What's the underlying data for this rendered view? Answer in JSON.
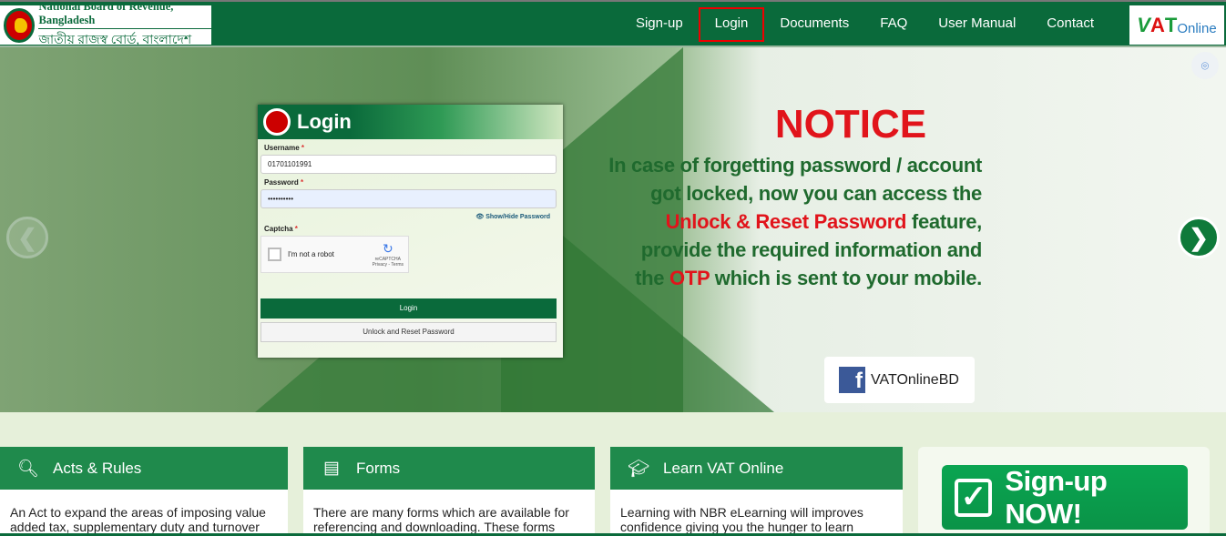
{
  "header": {
    "org_en": "National Board of Revenue, Bangladesh",
    "org_bn": "জাতীয় রাজস্ব বোর্ড, বাংলাদেশ",
    "nav": [
      "Sign-up",
      "Login",
      "Documents",
      "FAQ",
      "User Manual",
      "Contact"
    ],
    "active": "Login",
    "vat_logo": {
      "v": "V",
      "a": "A",
      "t": "T",
      "online": "Online"
    }
  },
  "hero": {
    "prev": "❮",
    "next": "❯",
    "zoom_icon": "⌾",
    "login": {
      "title": "Login",
      "username_label": "Username",
      "password_label": "Password",
      "required": "*",
      "username_value": "01701101991",
      "password_value": "••••••••••",
      "show_hide": "👁 Show/Hide Password",
      "captcha_label": "Captcha",
      "robot": "I'm not a robot",
      "recaptcha": "reCAPTCHA",
      "privacy": "Privacy - Terms",
      "login_btn": "Login",
      "unlock_btn": "Unlock and Reset Password"
    },
    "notice": {
      "title": "NOTICE",
      "l1": "In case of forgetting password / account",
      "l2": "got locked, now you can access the",
      "l3a": "Unlock & Reset Password",
      "l3b": " feature,",
      "l4": "provide the required information and",
      "l5a": "the ",
      "l5b": "OTP",
      "l5c": " which is sent to your mobile."
    },
    "facebook": "VATOnlineBD"
  },
  "cards": [
    {
      "title": "Acts & Rules",
      "icon": "search-icon",
      "text": "An Act to expand the areas of imposing value added tax, supplementary duty and turnover"
    },
    {
      "title": "Forms",
      "icon": "form-icon",
      "text": "There are many forms which are available for referencing and downloading. These forms"
    },
    {
      "title": "Learn VAT Online",
      "icon": "graduation-cap-icon",
      "text": "Learning with NBR eLearning will improves confidence giving you the hunger to learn"
    }
  ],
  "signup": "Sign-up NOW!",
  "colors": {
    "brand": "#0a6a3b",
    "notice_red": "#e1141b",
    "card": "#1f8a4c"
  }
}
